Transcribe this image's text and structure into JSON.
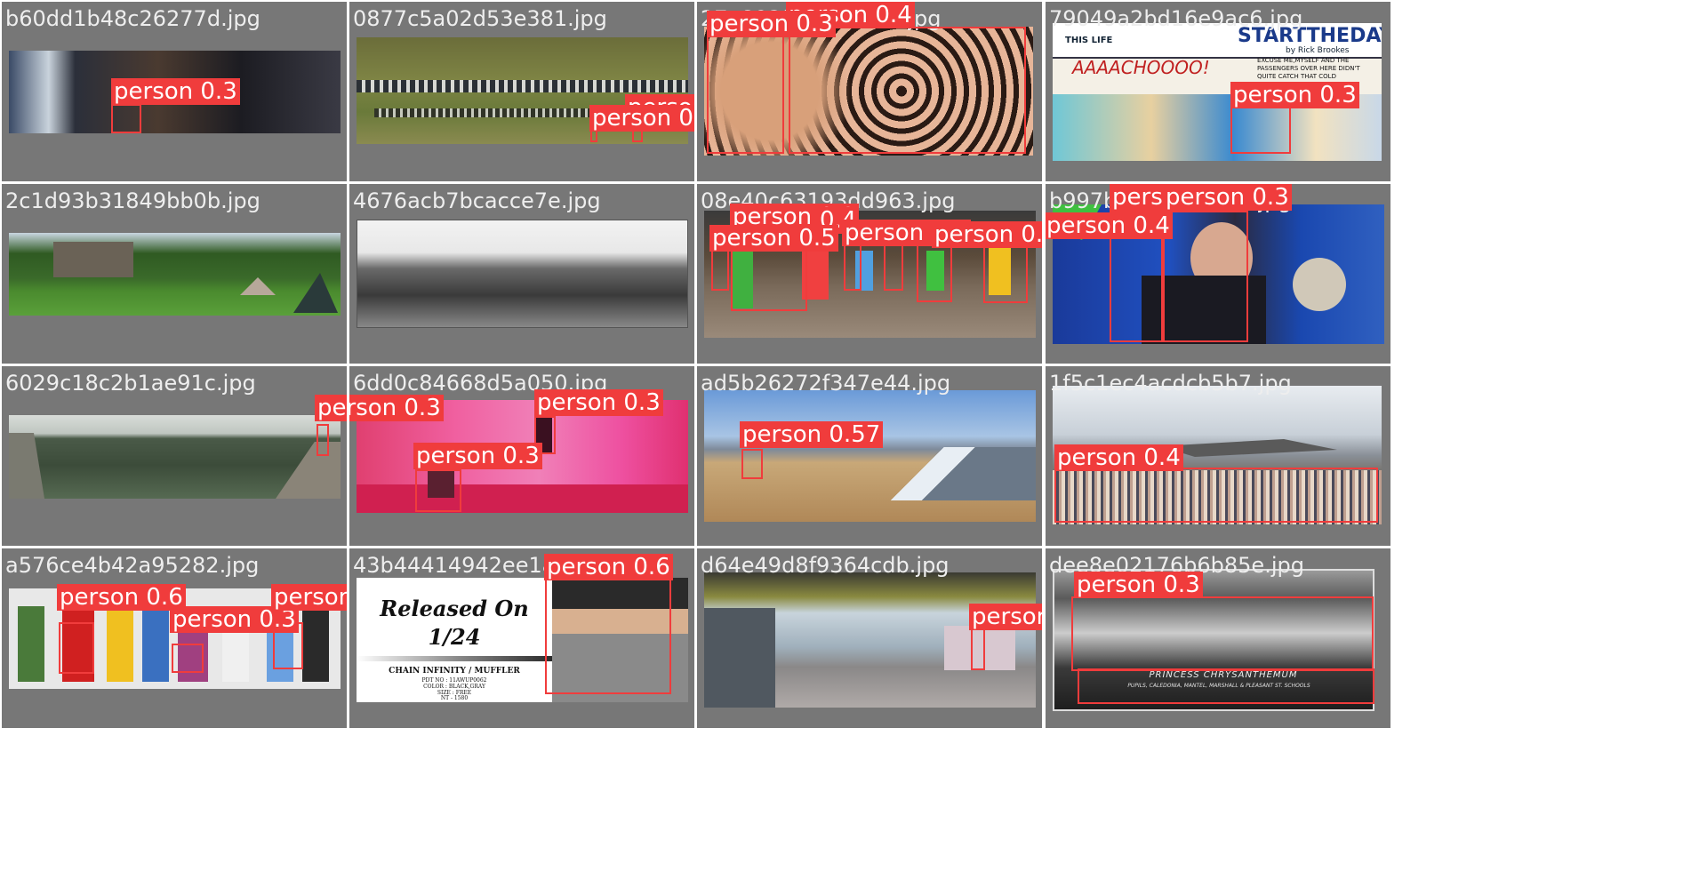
{
  "files": [
    "b60dd1b48c26277d.jpg",
    "0877c5a02d53e381.jpg",
    "27e892fa93b2cd1f.jpg",
    "79049a2bd16e9ac6.jpg",
    "2c1d93b31849bb0b.jpg",
    "4676acb7bcacce7e.jpg",
    "08e40c63193dd963.jpg",
    "b997b4c3d89f2fa1.jpg",
    "6029c18c2b1ae91c.jpg",
    "6dd0c84668d5a050.jpg",
    "ad5b26272f347e44.jpg",
    "1f5c1ec4acdcb5b7.jpg",
    "a576ce4b42a95282.jpg",
    "43b44414942ee1a7.jpg",
    "d64e49d8f9364cdb.jpg",
    "dee8e02176b6b85e.jpg"
  ],
  "labels": {
    "p03": "person 0.3",
    "p04": "person 0.4",
    "p05": "person 0.5",
    "p057": "person 0.57",
    "p06": "person 0.6",
    "p0_4_partial": "0.4",
    "p04_cut": "person 0.4",
    "p03_cut": "person 0.3"
  },
  "comic": {
    "header_left": "THIS LIFE",
    "title": "STARTTHEDAY",
    "byline": "by Rick Brookes",
    "shout": "AAAACHOOOO!",
    "bubble": "EXCUSE ME,MYSELF AND THE PASSENGERS OVER HERE DIDN'T QUITE CATCH THAT COLD"
  },
  "promo": {
    "line1": "Released On",
    "line2": "1/24",
    "product": "CHAIN INFINITY / MUFFLER",
    "spec1": "PDT NO : 11AWUP0062",
    "spec2": "COLOR : BLACK,GRAY",
    "spec3": "SIZE : FREE",
    "spec4": "NT - 1580"
  },
  "photo_caption": {
    "line1": "PRINCESS CHRYSANTHEMUM",
    "line2": "PUPILS, CALEDONIA, MANTEL, MARSHALL & PLEASANT ST. SCHOOLS"
  },
  "colors": {
    "box": "#f03c3c",
    "cell_bg": "#777777"
  }
}
